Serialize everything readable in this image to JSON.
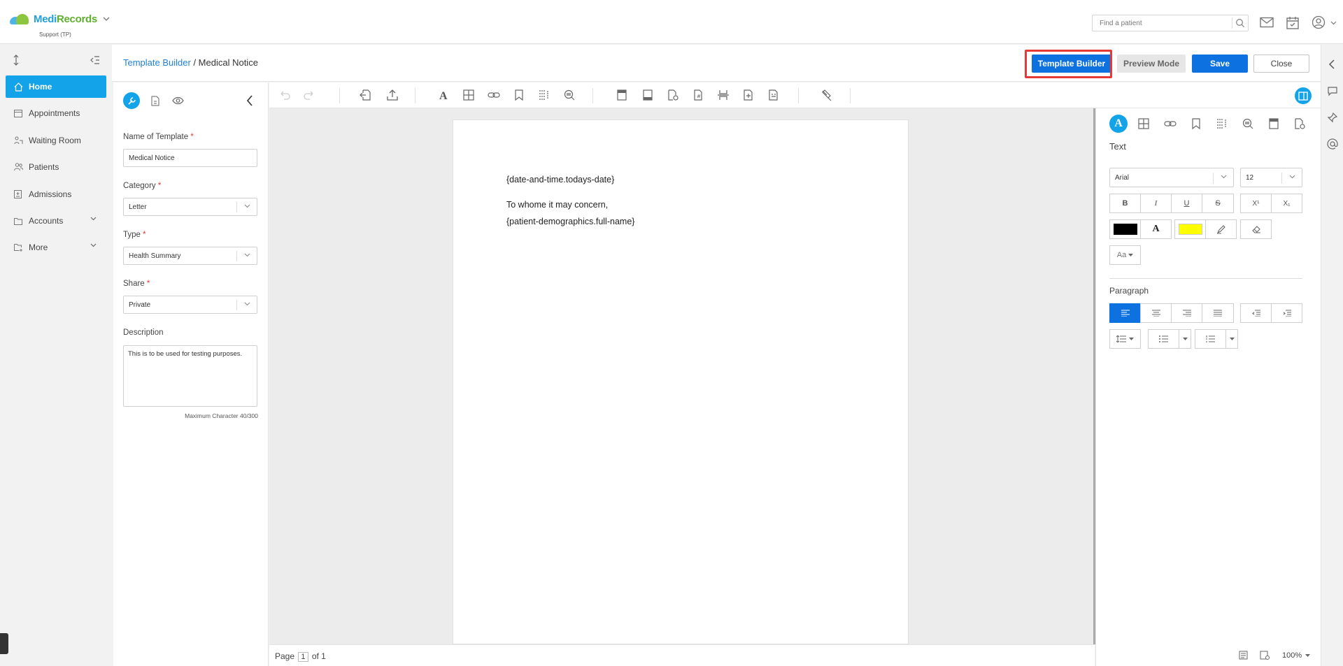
{
  "app": {
    "brand_part1": "Medi",
    "brand_part2": "Records",
    "subtitle": "Support (TP)"
  },
  "search": {
    "placeholder": "Find a patient"
  },
  "sidebar": {
    "items": [
      {
        "label": "Home",
        "icon": "home-icon",
        "active": true
      },
      {
        "label": "Appointments",
        "icon": "calendar-icon"
      },
      {
        "label": "Waiting Room",
        "icon": "waiting-room-icon"
      },
      {
        "label": "Patients",
        "icon": "patients-icon"
      },
      {
        "label": "Admissions",
        "icon": "admissions-icon"
      },
      {
        "label": "Accounts",
        "icon": "folder-icon",
        "expandable": true
      },
      {
        "label": "More",
        "icon": "more-icon",
        "expandable": true
      }
    ]
  },
  "breadcrumb": {
    "parent": "Template Builder",
    "separator": " / ",
    "current": "Medical Notice"
  },
  "header_buttons": {
    "template_builder": "Template Builder",
    "preview_mode": "Preview Mode",
    "save": "Save",
    "close": "Close"
  },
  "form": {
    "name_label": "Name of Template",
    "name_value": "Medical Notice",
    "category_label": "Category",
    "category_value": "Letter",
    "type_label": "Type",
    "type_value": "Health Summary",
    "share_label": "Share",
    "share_value": "Private",
    "description_label": "Description",
    "description_value": "This is to be used for testing purposes.",
    "char_count": "Maximum Character 40/300",
    "required_mark": "*"
  },
  "document": {
    "lines": [
      "{date-and-time.todays-date}",
      "To whome it may concern,",
      "{patient-demographics.full-name}"
    ]
  },
  "status_bar": {
    "page_label": "Page",
    "page_number": "1",
    "of_label": "of 1",
    "zoom": "100%"
  },
  "properties": {
    "text_title": "Text",
    "font_family": "Arial",
    "font_size": "12",
    "format_labels": {
      "bold": "B",
      "italic": "I",
      "underline": "U",
      "strike": "S",
      "superscript": "X¹",
      "subscript": "X₁",
      "font_color": "A",
      "case": "Aa"
    },
    "paragraph_title": "Paragraph",
    "font_color_swatch": "#000000",
    "highlight_swatch": "#ffff00"
  },
  "colors": {
    "accent": "#12a3e8",
    "primary_button": "#0d72e0",
    "annotation_red": "#e53935"
  }
}
